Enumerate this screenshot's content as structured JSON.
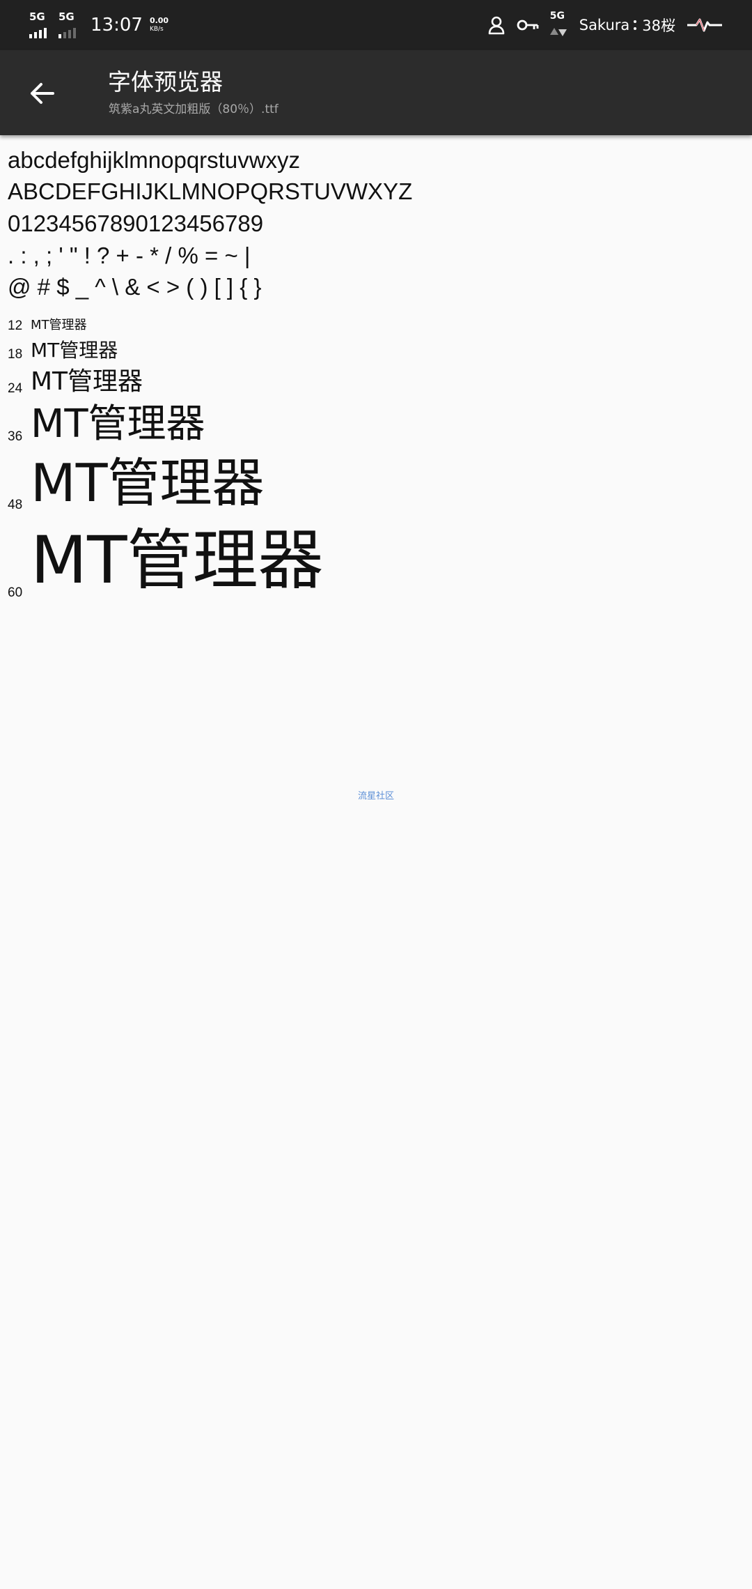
{
  "status_bar": {
    "signal1_label": "5G",
    "signal2_label": "5G",
    "time": "13:07",
    "speed_value": "0.00",
    "speed_unit": "KB/s",
    "network_label": "5G",
    "carrier": "Sakura",
    "battery_label": "38桜",
    "icons": [
      "person-icon",
      "vpn-key-icon",
      "network-activity-icon",
      "heartbeat-icon"
    ]
  },
  "app_bar": {
    "title": "字体预览器",
    "subtitle": "筑紫a丸英文加粗版（80％）.ttf",
    "back_icon": "back-arrow-icon"
  },
  "charset": [
    "abcdefghijklmnopqrstuvwxyz",
    "ABCDEFGHIJKLMNOPQRSTUVWXYZ",
    "01234567890123456789",
    ". : , ; ' \" ! ? + - * / % = ~ |",
    "@ # $ _ ^ \\ & < > ( ) [ ] { }"
  ],
  "sizes": [
    {
      "size": "12",
      "sample": "MT管理器"
    },
    {
      "size": "18",
      "sample": "MT管理器"
    },
    {
      "size": "24",
      "sample": "MT管理器"
    },
    {
      "size": "36",
      "sample": "MT管理器"
    },
    {
      "size": "48",
      "sample": "MT管理器"
    },
    {
      "size": "60",
      "sample": "MT管理器"
    }
  ],
  "footer": {
    "link_text": "流星社区"
  },
  "colors": {
    "status_bar_bg": "#212121",
    "app_bar_bg": "#2c2c2c",
    "page_bg": "#fafafa",
    "link": "#5b8ed6"
  }
}
